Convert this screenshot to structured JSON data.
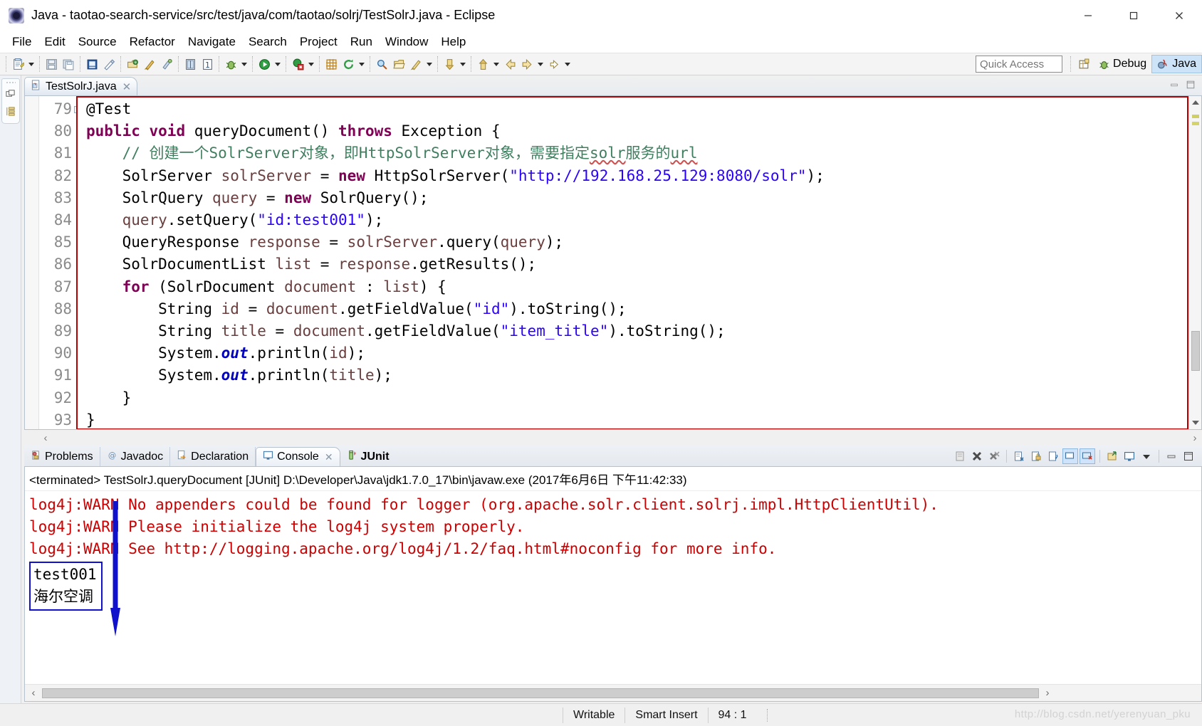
{
  "window": {
    "title": "Java - taotao-search-service/src/test/java/com/taotao/solrj/TestSolrJ.java - Eclipse",
    "app_icon": "eclipse-icon",
    "minimize": "–",
    "maximize": "□",
    "close": "✕"
  },
  "menubar": {
    "items": [
      "File",
      "Edit",
      "Source",
      "Refactor",
      "Navigate",
      "Search",
      "Project",
      "Run",
      "Window",
      "Help"
    ]
  },
  "toolbar": {
    "quick_access_placeholder": "Quick Access",
    "open_perspective_icon": "open-perspective-icon",
    "perspectives": [
      {
        "label": "Debug",
        "icon": "debug-perspective-icon",
        "active": false
      },
      {
        "label": "Java",
        "icon": "java-perspective-icon",
        "active": true
      }
    ],
    "buttons": [
      "new-wizard-icon",
      "save-icon",
      "save-all-icon",
      "print-icon",
      "toggle-mark-occurrences-icon",
      "new-java-package-icon",
      "new-java-class-icon",
      "open-type-icon",
      "open-task-icon",
      "debug-icon",
      "run-icon",
      "external-tools-icon",
      "new-annotation-icon",
      "refresh-icon",
      "search-icon",
      "open-resource-icon",
      "pencil-icon",
      "next-annotation-icon",
      "previous-annotation-icon",
      "back-icon",
      "forward-icon"
    ]
  },
  "editor": {
    "tab": {
      "label": "TestSolrJ.java",
      "icon": "java-file-icon",
      "close": "✕"
    },
    "minimize_icon": "minimize-view-icon",
    "maximize_icon": "maximize-view-icon",
    "first_line_number": 79,
    "lines": [
      {
        "no": "79",
        "fold": true,
        "html": "<span class=\"cmt\"></span>@Test"
      },
      {
        "no": "80",
        "fold": false,
        "html": "<span class=\"kw\">public</span> <span class=\"kw\">void</span> queryDocument() <span class=\"kw\">throws</span> Exception {"
      },
      {
        "no": "81",
        "fold": false,
        "html": "    <span class=\"cmt\">// 创建一个SolrServer对象，即HttpSolrServer对象，需要指定<span class=\"sq\">solr</span>服务的<span class=\"sq\">url</span></span>"
      },
      {
        "no": "82",
        "fold": false,
        "html": "    SolrServer <span class=\"loc\">solrServer</span> = <span class=\"kw\">new</span> HttpSolrServer(<span class=\"str\">\"http://192.168.25.129:8080/solr\"</span>);"
      },
      {
        "no": "83",
        "fold": false,
        "html": "    SolrQuery <span class=\"loc\">query</span> = <span class=\"kw\">new</span> SolrQuery();"
      },
      {
        "no": "84",
        "fold": false,
        "html": "    <span class=\"loc\">query</span>.setQuery(<span class=\"str\">\"id:test001\"</span>);"
      },
      {
        "no": "85",
        "fold": false,
        "html": "    QueryResponse <span class=\"loc\">response</span> = <span class=\"loc\">solrServer</span>.query(<span class=\"loc\">query</span>);"
      },
      {
        "no": "86",
        "fold": false,
        "html": "    SolrDocumentList <span class=\"loc\">list</span> = <span class=\"loc\">response</span>.getResults();"
      },
      {
        "no": "87",
        "fold": false,
        "html": "    <span class=\"kw\">for</span> (SolrDocument <span class=\"loc\">document</span> : <span class=\"loc\">list</span>) {"
      },
      {
        "no": "88",
        "fold": false,
        "html": "        String <span class=\"loc\">id</span> = <span class=\"loc\">document</span>.getFieldValue(<span class=\"str\">\"id\"</span>).toString();"
      },
      {
        "no": "89",
        "fold": false,
        "html": "        String <span class=\"loc\">title</span> = <span class=\"loc\">document</span>.getFieldValue(<span class=\"str\">\"item_title\"</span>).toString();"
      },
      {
        "no": "90",
        "fold": false,
        "html": "        System.<span class=\"fld\">out</span>.println(<span class=\"loc\">id</span>);"
      },
      {
        "no": "91",
        "fold": false,
        "html": "        System.<span class=\"fld\">out</span>.println(<span class=\"loc\">title</span>);"
      },
      {
        "no": "92",
        "fold": false,
        "html": "    }"
      },
      {
        "no": "93",
        "fold": false,
        "html": "}"
      }
    ]
  },
  "bottom_view": {
    "tabs": [
      {
        "label": "Problems",
        "icon": "problems-icon",
        "selected": false,
        "closable": false,
        "bold": false
      },
      {
        "label": "Javadoc",
        "icon": "javadoc-icon",
        "selected": false,
        "closable": false,
        "bold": false
      },
      {
        "label": "Declaration",
        "icon": "declaration-icon",
        "selected": false,
        "closable": false,
        "bold": false
      },
      {
        "label": "Console",
        "icon": "console-icon",
        "selected": true,
        "closable": true,
        "bold": false
      },
      {
        "label": "JUnit",
        "icon": "junit-icon",
        "selected": false,
        "closable": false,
        "bold": true
      }
    ],
    "tab_close_glyph": "✕",
    "tools": [
      "clear-console-icon",
      "terminate-icon",
      "remove-all-terminated-icon",
      "show-console-when-output-icon",
      "scroll-lock-icon",
      "word-wrap-icon",
      "pin-console-icon",
      "display-selected-console-icon",
      "open-console-icon",
      "display-console-icon",
      "view-menu-icon",
      "minimize-view-icon",
      "maximize-view-icon"
    ],
    "terminated_line": "<terminated> TestSolrJ.queryDocument [JUnit] D:\\Developer\\Java\\jdk1.7.0_17\\bin\\javaw.exe (2017年6月6日 下午11:42:33)",
    "console_output": [
      {
        "text": "log4j:WARN No appenders could be found for logger (org.apache.solr.client.solrj.impl.HttpClientUtil).",
        "kind": "warn"
      },
      {
        "text": "log4j:WARN Please initialize the log4j system properly.",
        "kind": "warn"
      },
      {
        "text": "log4j:WARN See http://logging.apache.org/log4j/1.2/faq.html#noconfig for more info.",
        "kind": "warn"
      }
    ],
    "highlighted_output": [
      "test001",
      "海尔空调"
    ],
    "scroll_left_glyph": "‹",
    "scroll_right_glyph": "›"
  },
  "statusbar": {
    "writable": "Writable",
    "insert_mode": "Smart Insert",
    "cursor_position": "94 : 1",
    "watermark": "http://blog.csdn.net/yerenyuan_pku"
  },
  "colors": {
    "selection_border": "#b40000",
    "annotation_arrow": "#1111cc",
    "warn_text": "#cc0000",
    "keyword": "#7f0055",
    "string": "#2a00ff",
    "comment": "#3f7f5f",
    "accent": "#cde3f7"
  }
}
